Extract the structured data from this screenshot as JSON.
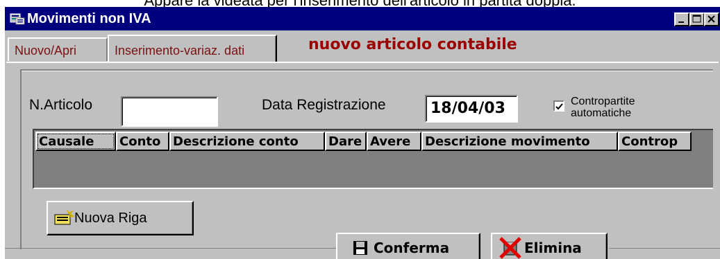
{
  "caption": "Appare la videata per l'inserimento dell'articolo in partita doppia.",
  "window": {
    "title": "Movimenti non IVA",
    "controls": {
      "minimize": "minimize",
      "maximize": "maximize",
      "close": "close"
    }
  },
  "tabs": [
    {
      "label": "Nuovo/Apri",
      "selected": false
    },
    {
      "label": "Inserimento-variaz. dati",
      "selected": true
    }
  ],
  "heading": "nuovo articolo contabile",
  "form": {
    "articolo_label": "N.Articolo",
    "articolo_value": "",
    "data_label": "Data Registrazione",
    "data_value": "18/04/03",
    "contropartite_label_line1": "Contropartite",
    "contropartite_label_line2": "automatiche",
    "contropartite_checked": true
  },
  "grid": {
    "columns": [
      "Causale",
      "Conto",
      "Descrizione conto",
      "Dare",
      "Avere",
      "Descrizione movimento",
      "Controp"
    ],
    "rows": []
  },
  "buttons": {
    "nuova_riga": "Nuova Riga",
    "conferma": "Conferma",
    "elimina": "Elimina"
  },
  "colors": {
    "title_bar": "#00007f",
    "face": "#c0c0c0",
    "heading": "#9b0000",
    "tab_text": "#7a1010",
    "grid_bg": "#808080"
  }
}
